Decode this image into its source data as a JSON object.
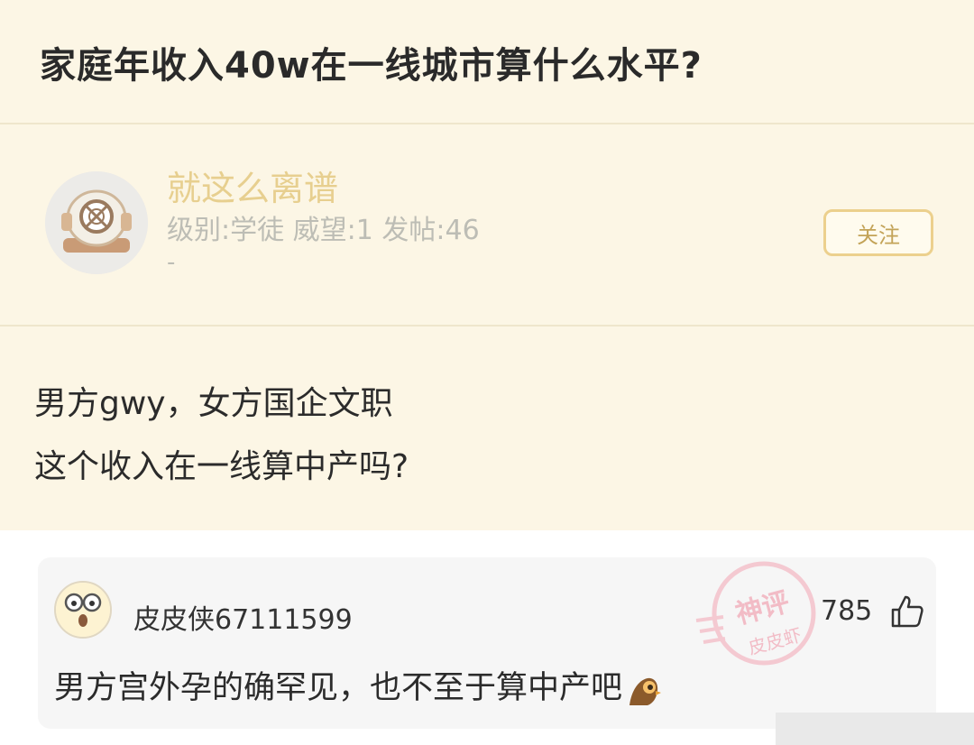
{
  "post": {
    "title": "家庭年收入40w在一线城市算什么水平?",
    "body_lines": [
      "男方gwy，女方国企文职",
      "这个收入在一线算中产吗?"
    ]
  },
  "author": {
    "name": "就这么离谱",
    "meta": "级别:学徒 威望:1 发帖:46",
    "signature": "-",
    "follow_label": "关注"
  },
  "comment": {
    "user": "皮皮侠67111599",
    "likes": "785",
    "text": "男方宫外孕的确罕见，也不至于算中产吧"
  },
  "watermark": {
    "line1": "神评",
    "line2": "皮皮虾"
  },
  "colors": {
    "accent": "#e7cf8f",
    "background": "#fcf6e5"
  }
}
